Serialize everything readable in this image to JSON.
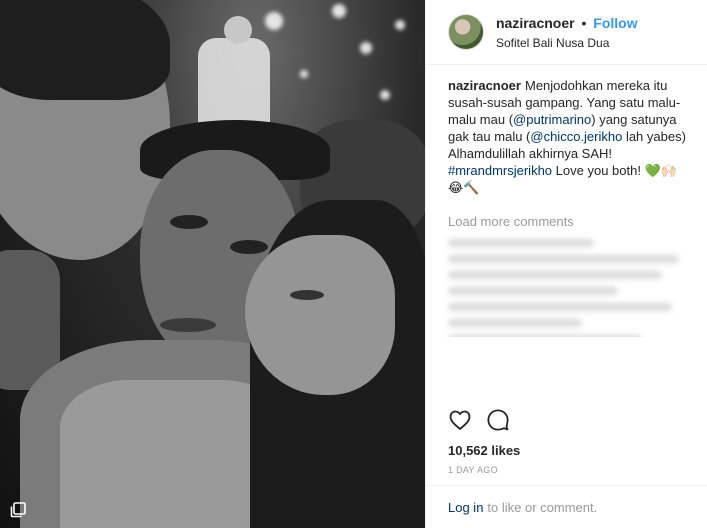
{
  "header": {
    "username": "naziracnoer",
    "separator": "•",
    "follow_label": "Follow",
    "location": "Sofitel Bali Nusa Dua"
  },
  "caption": {
    "username": "naziracnoer",
    "text_1": "Menjodohkan mereka itu susah-susah gampang. Yang satu malu-malu mau (",
    "mention_1": "@putrimarino",
    "text_2": ") yang satunya gak tau malu (",
    "mention_2": "@chicco.jerikho",
    "text_3": " lah yabes) Alhamdulillah akhirnya SAH! ",
    "hashtag": "#mrandmrsjerikho",
    "text_4": " Love you both! 💚🙌🏻 😂🔨"
  },
  "load_more_label": "Load more comments",
  "likes_label": "10,562 likes",
  "date_label": "1 DAY AGO",
  "footer": {
    "login_label": "Log in",
    "rest_label": "to like or comment."
  },
  "colors": {
    "link_blue": "#3897f0",
    "mention_navy": "#003569",
    "muted_gray": "#999999"
  },
  "icons": {
    "like": "heart-outline-icon",
    "comment": "speech-bubble-icon",
    "multi": "multiple-posts-icon"
  }
}
